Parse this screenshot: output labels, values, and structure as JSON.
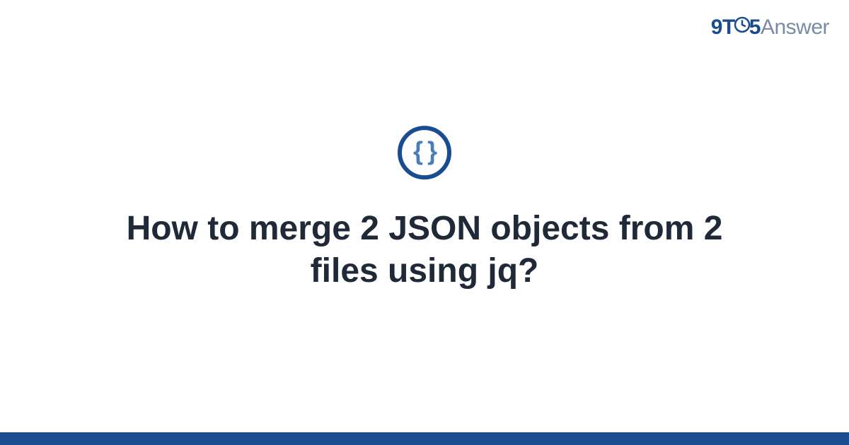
{
  "logo": {
    "part_9": "9",
    "part_t": "T",
    "part_5": "5",
    "part_answer": "Answer"
  },
  "icon": {
    "symbol": "{ }",
    "name": "json-braces-icon"
  },
  "title": "How to merge 2 JSON objects from 2 files using jq?",
  "colors": {
    "primary": "#1a4d8f",
    "secondary": "#7a8ba8",
    "brace": "#4a7db8",
    "text": "#1f2937"
  }
}
